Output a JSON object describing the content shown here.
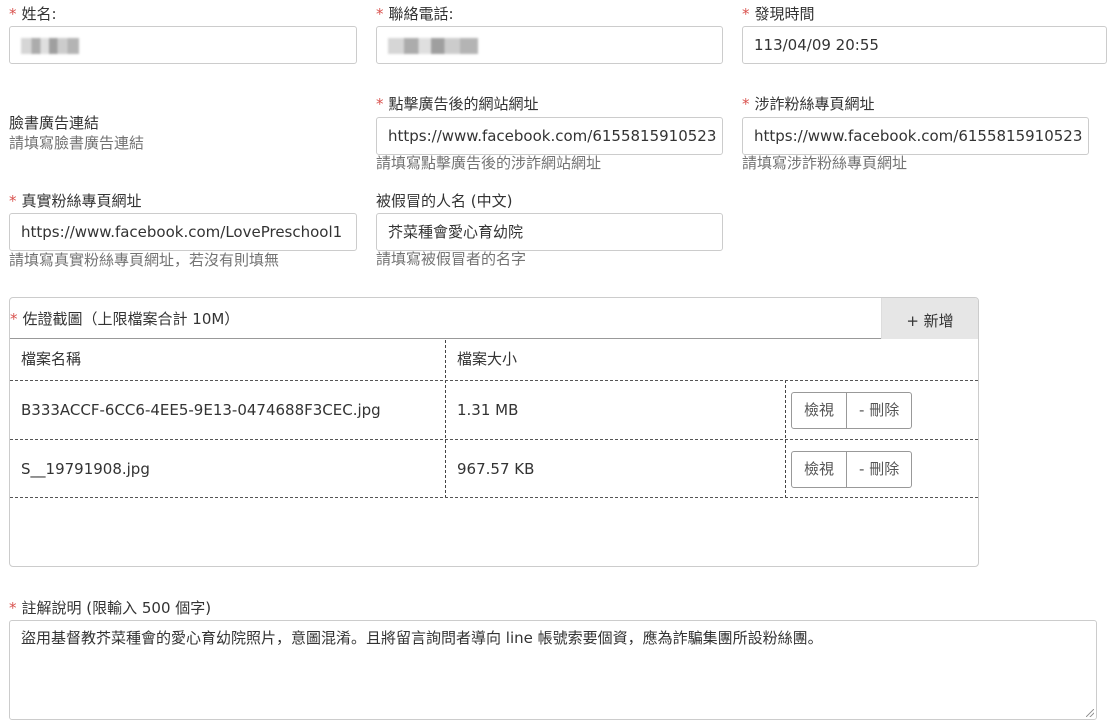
{
  "fields": {
    "name": {
      "label": "姓名:",
      "value": ""
    },
    "phone": {
      "label": "聯絡電話:",
      "value": ""
    },
    "found_time": {
      "label": "發現時間",
      "value": "113/04/09 20:55"
    },
    "ad_link": {
      "label": "臉書廣告連結",
      "help": "請填寫臉書廣告連結"
    },
    "clicked_url": {
      "label": "點擊廣告後的網站網址",
      "value": "https://www.facebook.com/6155815910523",
      "help": "請填寫點擊廣告後的涉詐網站網址"
    },
    "scam_page": {
      "label": "涉詐粉絲專頁網址",
      "value": "https://www.facebook.com/6155815910523",
      "help": "請填寫涉詐粉絲專頁網址"
    },
    "real_page": {
      "label": "真實粉絲專頁網址",
      "value": "https://www.facebook.com/LovePreschool1",
      "help": "請填寫真實粉絲專頁網址，若沒有則填無"
    },
    "impersonated": {
      "label": "被假冒的人名 (中文)",
      "value": "芥菜種會愛心育幼院",
      "help": "請填寫被假冒者的名字"
    }
  },
  "required_mark": "*",
  "evidence": {
    "title": "佐證截圖（上限檔案合計 10M）",
    "add_label": "+ 新增",
    "columns": [
      "檔案名稱",
      "檔案大小"
    ],
    "view_label": "檢視",
    "delete_label": "- 刪除",
    "files": [
      {
        "name": "B333ACCF-6CC6-4EE5-9E13-0474688F3CEC.jpg",
        "size": "1.31 MB"
      },
      {
        "name": "S__19791908.jpg",
        "size": "967.57 KB"
      }
    ]
  },
  "notes": {
    "label": "註解說明 (限輸入 500 個字)",
    "value": "盜用基督教芥菜種會的愛心育幼院照片，意圖混淆。且將留言詢問者導向 line 帳號索要個資，應為詐騙集團所設粉絲團。"
  }
}
